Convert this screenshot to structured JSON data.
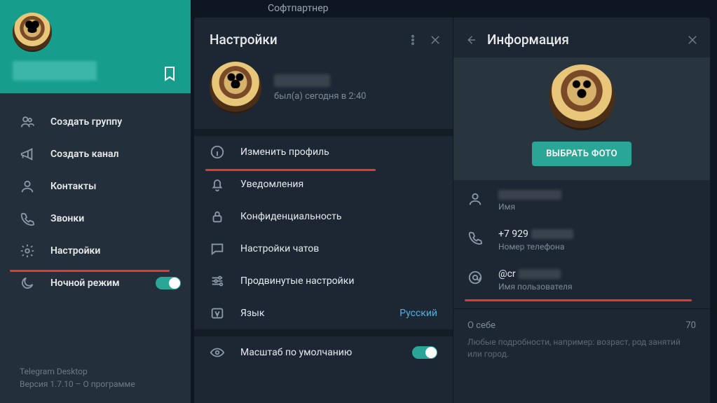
{
  "colors": {
    "accent": "#169d8b",
    "danger": "#e23b2e",
    "link": "#4fb0df"
  },
  "chat_header": {
    "contact_name": "Софтпартнер"
  },
  "sidebar": {
    "bookmark_icon": "bookmark",
    "items": [
      {
        "icon": "group",
        "label": "Создать группу"
      },
      {
        "icon": "megaphone",
        "label": "Создать канал"
      },
      {
        "icon": "user",
        "label": "Контакты"
      },
      {
        "icon": "phone",
        "label": "Звонки"
      },
      {
        "icon": "gear",
        "label": "Настройки",
        "highlight": true
      },
      {
        "icon": "moon",
        "label": "Ночной режим",
        "toggle": true,
        "toggle_on": true
      }
    ],
    "footer": {
      "app_name": "Telegram Desktop",
      "version_line": "Версия 1.7.10 – О программе"
    }
  },
  "settings": {
    "title": "Настройки",
    "status": "был(а) сегодня в 2:40",
    "items": [
      {
        "icon": "info",
        "label": "Изменить профиль",
        "highlight": true
      },
      {
        "icon": "bell",
        "label": "Уведомления"
      },
      {
        "icon": "lock",
        "label": "Конфиденциальность"
      },
      {
        "icon": "chat",
        "label": "Настройки чатов"
      },
      {
        "icon": "sliders",
        "label": "Продвинутые настройки"
      },
      {
        "icon": "lang",
        "label": "Язык",
        "value": "Русский"
      }
    ],
    "scale": {
      "label": "Масштаб по умолчанию",
      "toggle_on": true
    }
  },
  "info": {
    "title": "Информация",
    "photo_button": "ВЫБРАТЬ ФОТО",
    "fields": {
      "name": {
        "label": "Имя",
        "value_visible": ""
      },
      "phone": {
        "label": "Номер телефона",
        "value_visible": "+7 929"
      },
      "username": {
        "label": "Имя пользователя",
        "value_visible": "@cr",
        "highlight": true
      }
    },
    "bio": {
      "label": "О себе",
      "counter": "70",
      "hint": "Любые подробности, например: возраст, род занятий или город."
    }
  }
}
